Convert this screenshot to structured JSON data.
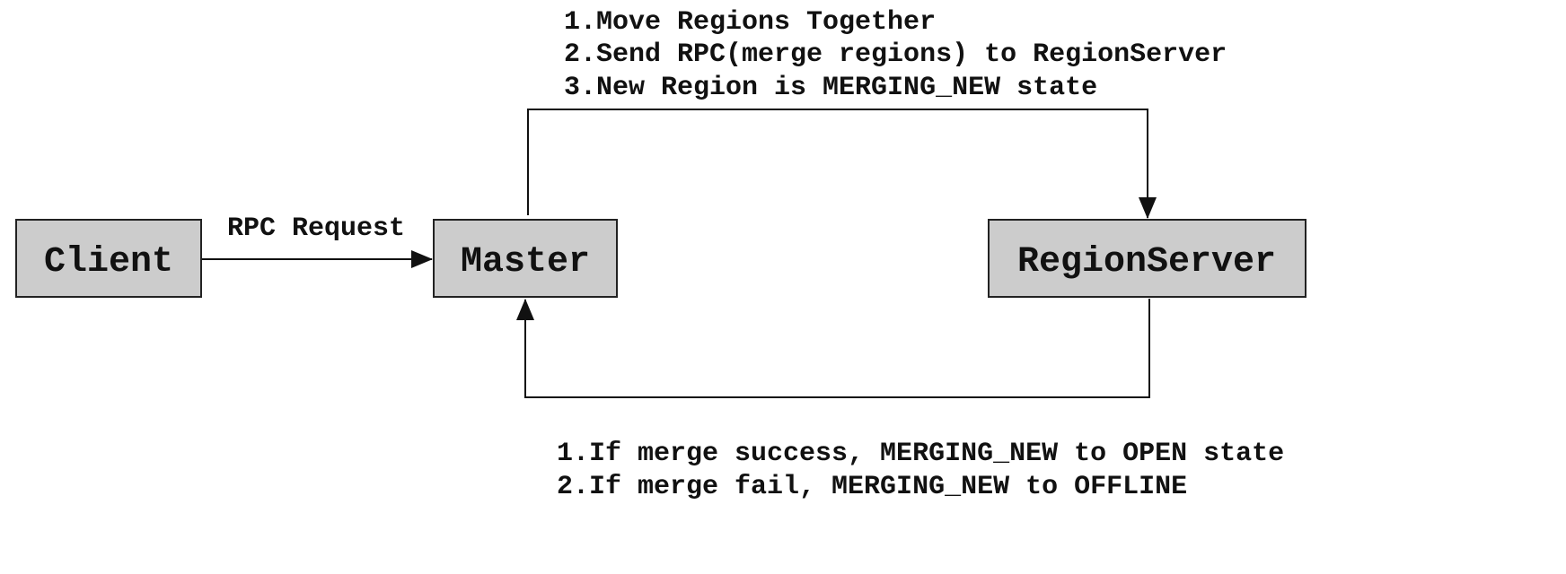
{
  "nodes": {
    "client": "Client",
    "master": "Master",
    "region_server": "RegionServer"
  },
  "edges": {
    "client_to_master": "RPC Request"
  },
  "notes": {
    "master_to_rs": [
      "1.Move Regions Together",
      "2.Send RPC(merge regions) to RegionServer",
      "3.New Region is MERGING_NEW state"
    ],
    "rs_to_master": [
      "1.If merge success, MERGING_NEW to OPEN state",
      "2.If merge fail, MERGING_NEW to OFFLINE"
    ]
  },
  "colors": {
    "box_fill": "#cccccc",
    "line": "#111111"
  }
}
